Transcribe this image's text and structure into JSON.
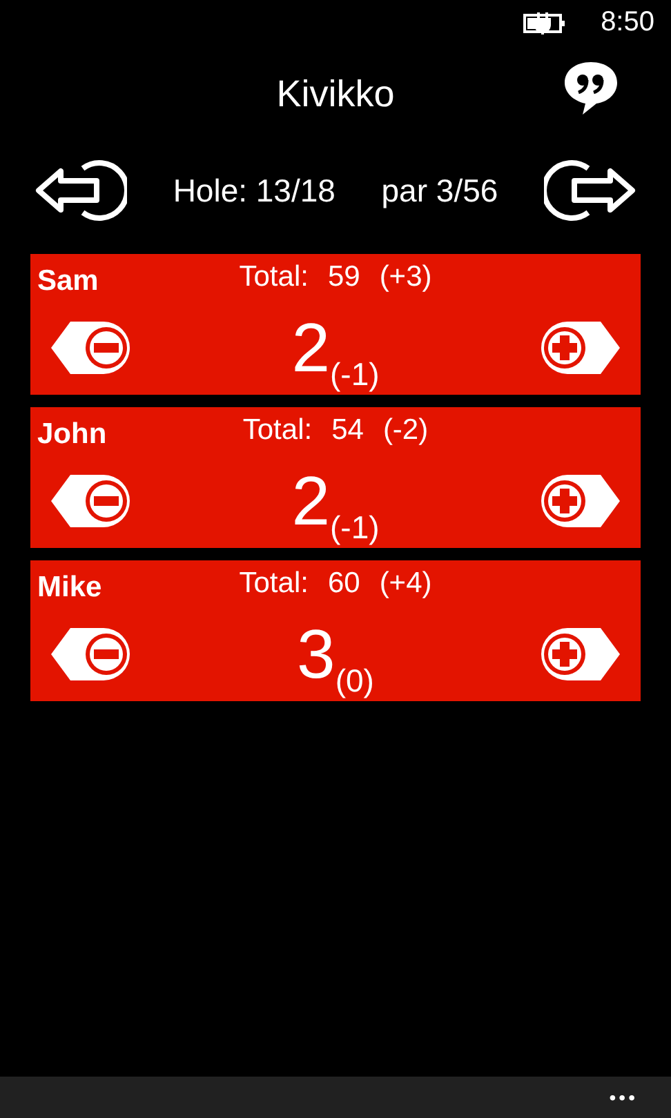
{
  "status_bar": {
    "time": "8:50"
  },
  "title": "Kivikko",
  "hole": {
    "label": "Hole: 13/18",
    "par": "par 3/56"
  },
  "players": [
    {
      "name": "Sam",
      "total_label": "Total:",
      "total": "59",
      "total_diff": "(+3)",
      "score": "2",
      "score_diff": "(-1)"
    },
    {
      "name": "John",
      "total_label": "Total:",
      "total": "54",
      "total_diff": "(-2)",
      "score": "2",
      "score_diff": "(-1)"
    },
    {
      "name": "Mike",
      "total_label": "Total:",
      "total": "60",
      "total_diff": "(+4)",
      "score": "3",
      "score_diff": "(0)"
    }
  ],
  "app_bar": {
    "more": "•••"
  }
}
